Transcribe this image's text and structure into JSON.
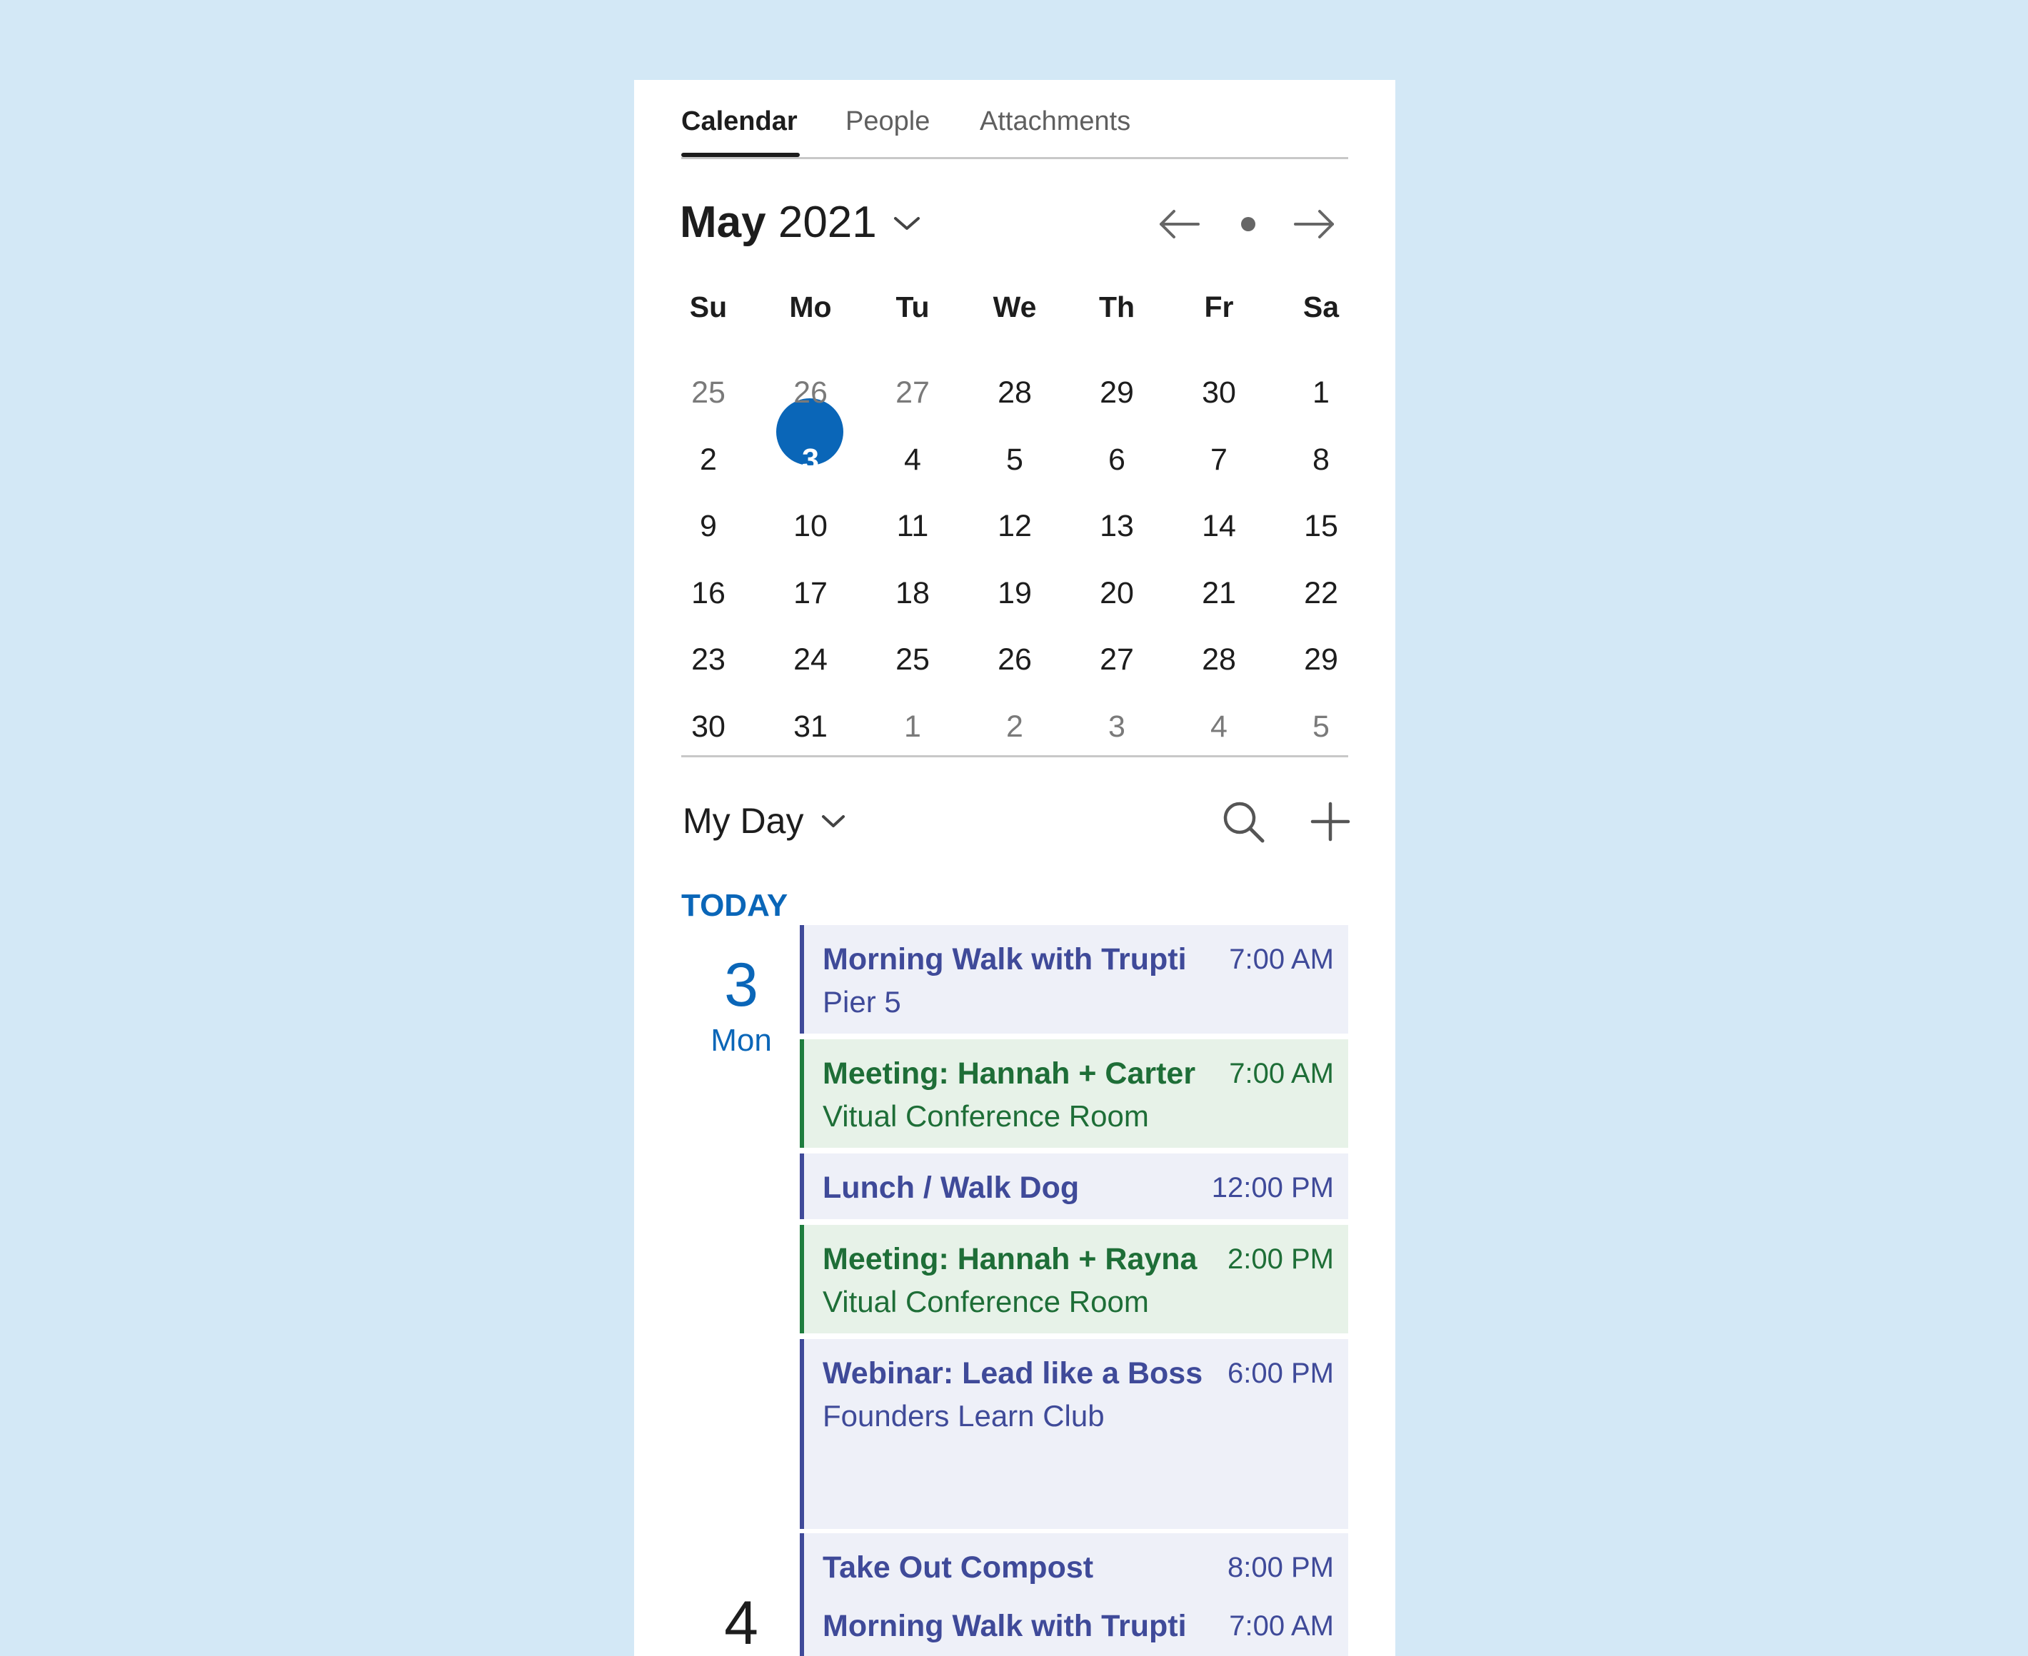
{
  "tabs": [
    {
      "label": "Calendar",
      "active": true
    },
    {
      "label": "People",
      "active": false
    },
    {
      "label": "Attachments",
      "active": false
    }
  ],
  "month_header": {
    "month": "May",
    "year": "2021",
    "dropdown_icon": "chevron-down-icon",
    "prev_icon": "arrow-left-icon",
    "today_icon": "dot-icon",
    "next_icon": "arrow-right-icon"
  },
  "weekdays": [
    "Su",
    "Mo",
    "Tu",
    "We",
    "Th",
    "Fr",
    "Sa"
  ],
  "weeks": [
    [
      {
        "d": "25",
        "m": true
      },
      {
        "d": "26",
        "m": true
      },
      {
        "d": "27",
        "m": true
      },
      {
        "d": "28",
        "m": false
      },
      {
        "d": "29",
        "m": false
      },
      {
        "d": "30",
        "m": false
      },
      {
        "d": "1",
        "m": false
      }
    ],
    [
      {
        "d": "2",
        "m": false
      },
      {
        "d": "3",
        "m": false,
        "selected": true
      },
      {
        "d": "4",
        "m": false
      },
      {
        "d": "5",
        "m": false
      },
      {
        "d": "6",
        "m": false
      },
      {
        "d": "7",
        "m": false
      },
      {
        "d": "8",
        "m": false
      }
    ],
    [
      {
        "d": "9",
        "m": false
      },
      {
        "d": "10",
        "m": false
      },
      {
        "d": "11",
        "m": false
      },
      {
        "d": "12",
        "m": false
      },
      {
        "d": "13",
        "m": false
      },
      {
        "d": "14",
        "m": false
      },
      {
        "d": "15",
        "m": false
      }
    ],
    [
      {
        "d": "16",
        "m": false
      },
      {
        "d": "17",
        "m": false
      },
      {
        "d": "18",
        "m": false
      },
      {
        "d": "19",
        "m": false
      },
      {
        "d": "20",
        "m": false
      },
      {
        "d": "21",
        "m": false
      },
      {
        "d": "22",
        "m": false
      }
    ],
    [
      {
        "d": "23",
        "m": false
      },
      {
        "d": "24",
        "m": false
      },
      {
        "d": "25",
        "m": false
      },
      {
        "d": "26",
        "m": false
      },
      {
        "d": "27",
        "m": false
      },
      {
        "d": "28",
        "m": false
      },
      {
        "d": "29",
        "m": false
      }
    ],
    [
      {
        "d": "30",
        "m": false
      },
      {
        "d": "31",
        "m": false
      },
      {
        "d": "1",
        "m": true
      },
      {
        "d": "2",
        "m": true
      },
      {
        "d": "3",
        "m": true
      },
      {
        "d": "4",
        "m": true
      },
      {
        "d": "5",
        "m": true
      }
    ]
  ],
  "my_day": {
    "label": "My Day",
    "search_icon": "search-icon",
    "add_icon": "plus-icon"
  },
  "agenda": {
    "today_label": "TODAY",
    "today": {
      "day_number": "3",
      "weekday": "Mon",
      "events": [
        {
          "title": "Morning Walk with Trupti",
          "time": "7:00 AM",
          "location": "Pier 5",
          "color": "blue"
        },
        {
          "title": "Meeting: Hannah + Carter",
          "time": "7:00 AM",
          "location": "Vitual Conference Room",
          "color": "green"
        },
        {
          "title": "Lunch / Walk Dog",
          "time": "12:00 PM",
          "location": "",
          "color": "blue"
        },
        {
          "title": "Meeting: Hannah + Rayna",
          "time": "2:00 PM",
          "location": "Vitual Conference Room",
          "color": "green"
        },
        {
          "title": "Webinar: Lead like a Boss",
          "time": "6:00 PM",
          "location": "Founders Learn Club",
          "color": "blue"
        },
        {
          "title": "Take Out Compost",
          "time": "8:00 PM",
          "location": "",
          "color": "blue"
        }
      ]
    },
    "next_day": {
      "day_number": "4",
      "events": [
        {
          "title": "Morning Walk with Trupti",
          "time": "7:00 AM",
          "color": "blue"
        }
      ]
    }
  },
  "colors": {
    "background": "#d3e8f6",
    "accent": "#0a66b8",
    "event_blue": "#3f4a99",
    "event_blue_bg": "#eef0f8",
    "event_green": "#1e6e37",
    "event_green_bg": "#e7f2e8"
  }
}
